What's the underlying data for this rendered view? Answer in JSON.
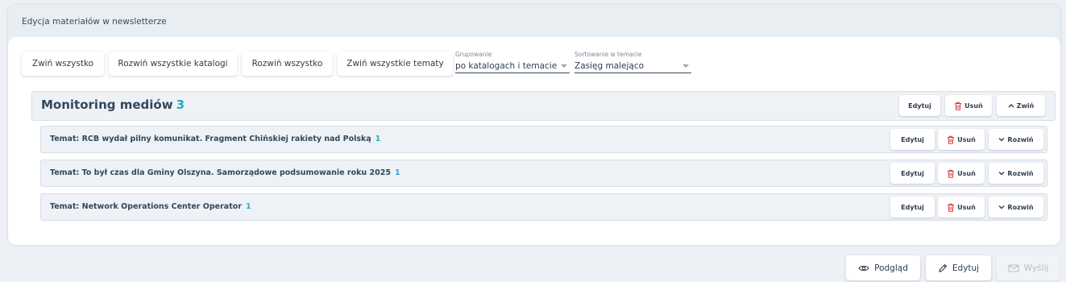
{
  "panel": {
    "title": "Edycja materiałów w newsletterze"
  },
  "toolbar": {
    "collapse_all": "Zwiń wszystko",
    "expand_all_catalogs": "Rozwiń wszystkie katalogi",
    "expand_all": "Rozwiń wszystko",
    "collapse_all_topics": "Zwiń wszystkie tematy",
    "grouping": {
      "label": "Grupowanie",
      "value": "po katalogach i temacie"
    },
    "sorting": {
      "label": "Sortowanie w temacie",
      "value": "Zasięg malejąco"
    }
  },
  "catalog": {
    "name": "Monitoring mediów",
    "count": "3",
    "edit_label": "Edytuj",
    "delete_label": "Usuń",
    "toggle_label": "Zwiń"
  },
  "topics": [
    {
      "title": "Temat: RCB wydał pilny komunikat. Fragment Chińskiej rakiety nad Polską",
      "count": "1",
      "edit_label": "Edytuj",
      "delete_label": "Usuń",
      "toggle_label": "Rozwiń"
    },
    {
      "title": "Temat: To był czas dla Gminy Olszyna. Samorządowe podsumowanie roku 2025",
      "count": "1",
      "edit_label": "Edytuj",
      "delete_label": "Usuń",
      "toggle_label": "Rozwiń"
    },
    {
      "title": "Temat: Network Operations Center Operator",
      "count": "1",
      "edit_label": "Edytuj",
      "delete_label": "Usuń",
      "toggle_label": "Rozwiń"
    }
  ],
  "footer": {
    "preview_label": "Podgląd",
    "edit_label": "Edytuj",
    "send_label": "Wyślij"
  },
  "colors": {
    "accent": "#2aa8c4",
    "delete": "#e0393e",
    "row_bg": "#eef2f6"
  }
}
